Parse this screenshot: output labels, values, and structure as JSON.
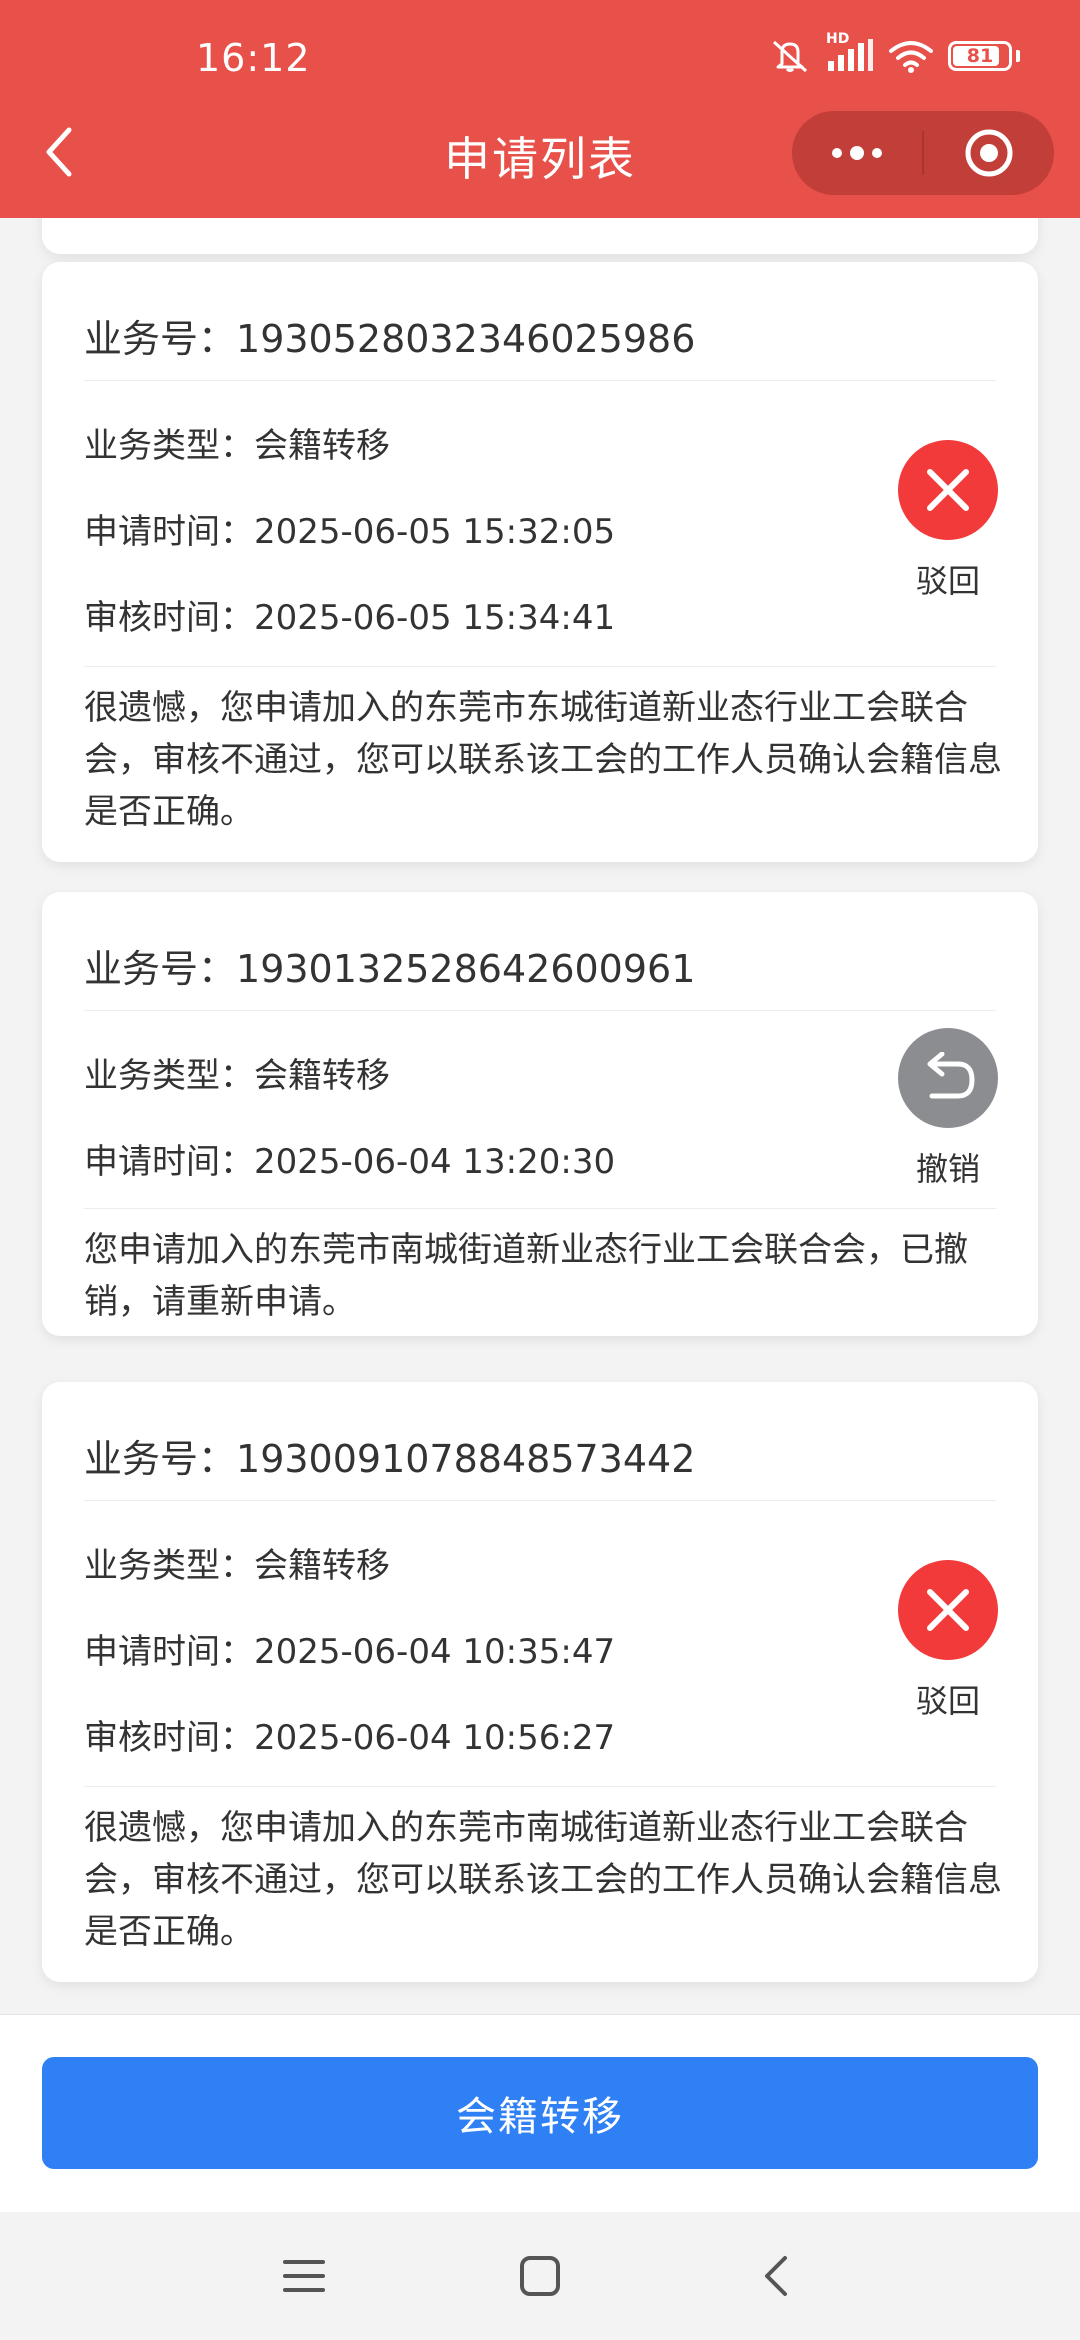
{
  "status_bar": {
    "time": "16:12",
    "battery": "81",
    "hd_label": "HD"
  },
  "nav": {
    "title": "申请列表",
    "back_icon": "chevron-left-icon",
    "more_icon": "more-dots-icon",
    "close_icon": "target-circle-icon"
  },
  "cards": [
    {
      "business_no_label": "业务号：",
      "business_no": "1930528032346025986",
      "type_label": "业务类型：",
      "type_value": "会籍转移",
      "apply_time_label": "申请时间：",
      "apply_time": "2025-06-05 15:32:05",
      "review_time_label": "审核时间：",
      "review_time": "2025-06-05 15:34:41",
      "status": "驳回",
      "status_icon": "close-x-icon",
      "status_color": "#f23a3a",
      "message": "很遗憾，您申请加入的东莞市东城街道新业态行业工会联合会，审核不通过，您可以联系该工会的工作人员确认会籍信息是否正确。"
    },
    {
      "business_no_label": "业务号：",
      "business_no": "1930132528642600961",
      "type_label": "业务类型：",
      "type_value": "会籍转移",
      "apply_time_label": "申请时间：",
      "apply_time": "2025-06-04 13:20:30",
      "status": "撤销",
      "status_icon": "undo-arrow-icon",
      "status_color": "#8b8d91",
      "message": "您申请加入的东莞市南城街道新业态行业工会联合会，已撤销，请重新申请。"
    },
    {
      "business_no_label": "业务号：",
      "business_no": "1930091078848573442",
      "type_label": "业务类型：",
      "type_value": "会籍转移",
      "apply_time_label": "申请时间：",
      "apply_time": "2025-06-04 10:35:47",
      "review_time_label": "审核时间：",
      "review_time": "2025-06-04 10:56:27",
      "status": "驳回",
      "status_icon": "close-x-icon",
      "status_color": "#f23a3a",
      "message": "很遗憾，您申请加入的东莞市南城街道新业态行业工会联合会，审核不通过，您可以联系该工会的工作人员确认会籍信息是否正确。"
    }
  ],
  "bottom": {
    "primary_button": "会籍转移"
  },
  "colors": {
    "header": "#e8504a",
    "primary": "#2f80f5",
    "rejected": "#f23a3a",
    "revoked": "#8b8d91"
  }
}
